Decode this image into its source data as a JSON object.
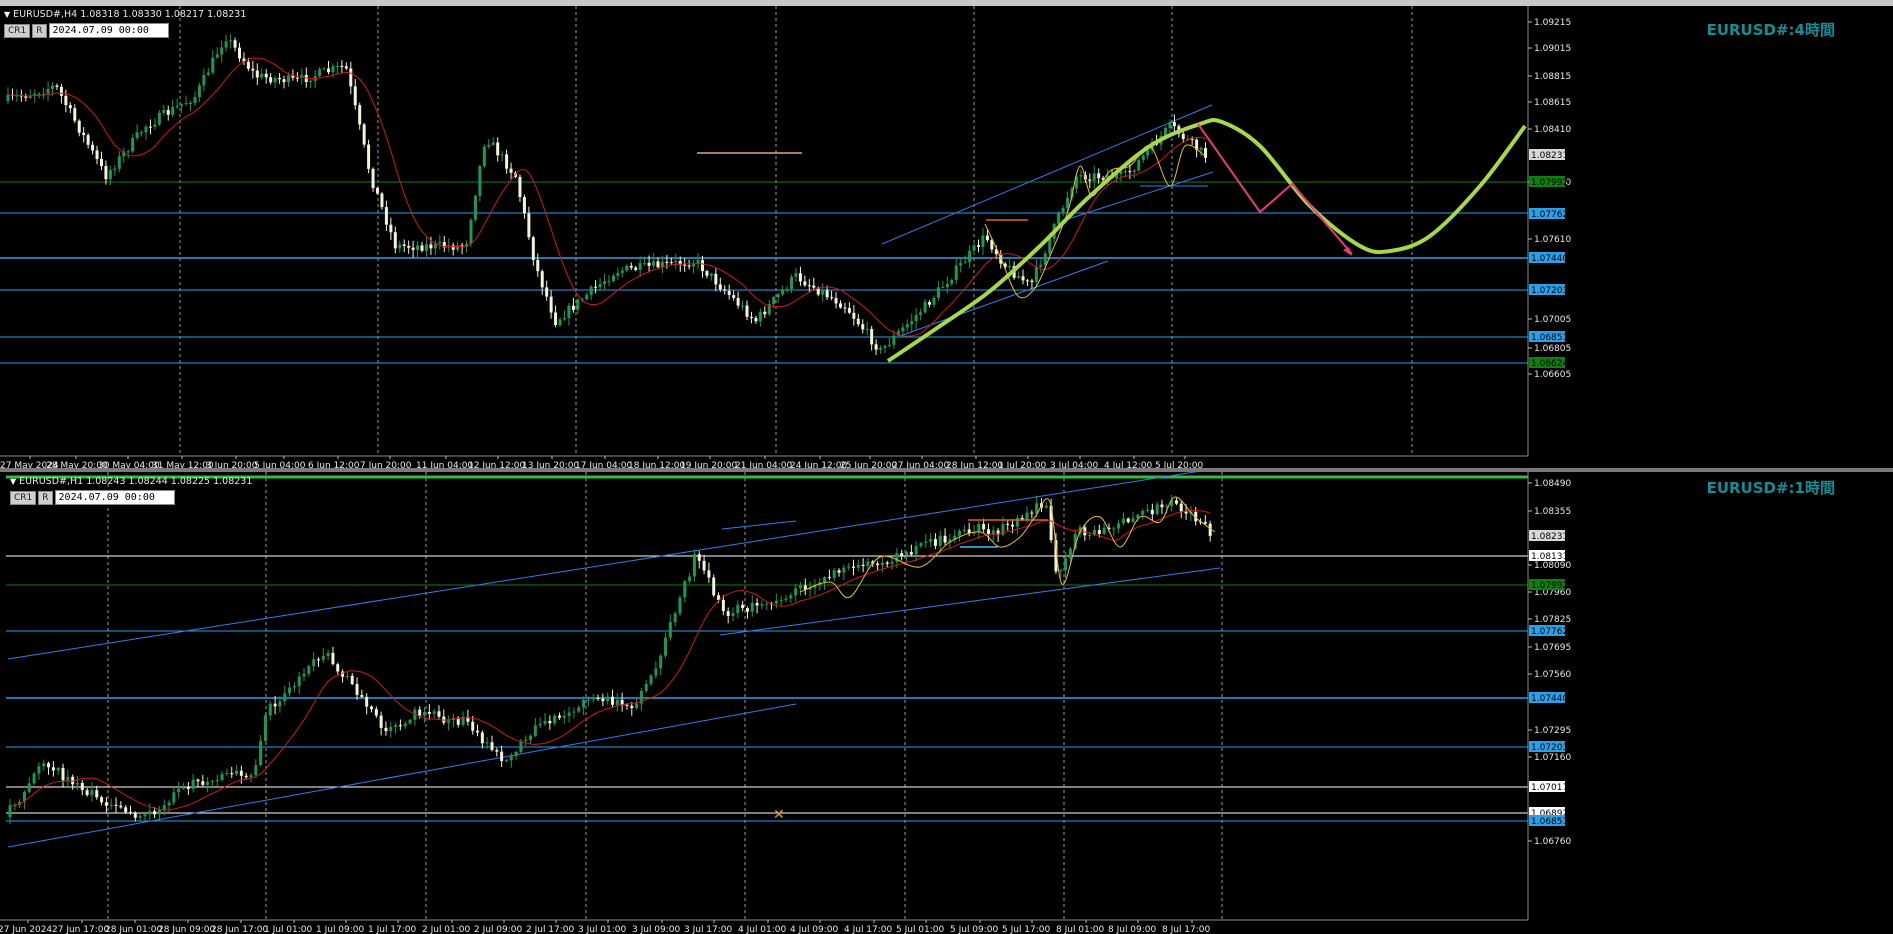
{
  "colors": {
    "background": "#000000",
    "bull": "#1a9a55",
    "bear": "#f4f4d8",
    "ma": "#d11818",
    "hline": "#2aa0e8",
    "trend": "#2f7fe8",
    "green_curve": "#a8d848",
    "zigzag": "#e8c020",
    "arrow": "#e83a78",
    "title": "#0f8f96",
    "green_level": "#0f7f0f"
  },
  "top_pane": {
    "header": "EURUSD#,H4  1.08318 1.08330 1.08217 1.08231",
    "btn_cr": "CR1",
    "btn_r": "R",
    "date_value": "2024.07.09 00:00",
    "title": "EURUSD#:4時間",
    "price_labels": [
      "1.09215",
      "1.09015",
      "1.08815",
      "1.08615",
      "1.08410",
      "1.08010",
      "1.07610",
      "1.07005",
      "1.06805",
      "1.06605"
    ],
    "level_tags": [
      {
        "text": "1.08231",
        "kind": "current"
      },
      {
        "text": "1.07992",
        "kind": "green"
      },
      {
        "text": "1.07762",
        "kind": "blue"
      },
      {
        "text": "1.07440",
        "kind": "blue"
      },
      {
        "text": "1.07203",
        "kind": "blue"
      },
      {
        "text": "1.06851",
        "kind": "blue"
      },
      {
        "text": "1.06624",
        "kind": "green"
      }
    ],
    "time_labels": [
      "27 May 2024",
      "28 May 20:00",
      "30 May 04:00",
      "31 May 12:00",
      "3 Jun 20:00",
      "5 Jun 04:00",
      "6 Jun 12:00",
      "7 Jun 20:00",
      "11 Jun 04:00",
      "12 Jun 12:00",
      "13 Jun 20:00",
      "17 Jun 04:00",
      "18 Jun 12:00",
      "19 Jun 20:00",
      "21 Jun 04:00",
      "24 Jun 12:00",
      "25 Jun 20:00",
      "27 Jun 04:00",
      "28 Jun 12:00",
      "1 Jul 20:00",
      "3 Jul 04:00",
      "4 Jul 12:00",
      "5 Jul 20:00"
    ]
  },
  "bottom_pane": {
    "header": "EURUSD#,H1  1.08243 1.08244 1.08225 1.08231",
    "btn_cr": "CR1",
    "btn_r": "R",
    "date_value": "2024.07.09 00:00",
    "title": "EURUSD#:1時間",
    "price_labels": [
      "1.08490",
      "1.08355",
      "1.08090",
      "1.07960",
      "1.07825",
      "1.07695",
      "1.07560",
      "1.07295",
      "1.07160",
      "1.06760"
    ],
    "level_tags": [
      {
        "text": "1.08231",
        "kind": "current"
      },
      {
        "text": "1.08131",
        "kind": "white"
      },
      {
        "text": "1.07992",
        "kind": "green"
      },
      {
        "text": "1.07762",
        "kind": "blue"
      },
      {
        "text": "1.07440",
        "kind": "blue"
      },
      {
        "text": "1.07203",
        "kind": "blue"
      },
      {
        "text": "1.07017",
        "kind": "white"
      },
      {
        "text": "1.06892",
        "kind": "white"
      },
      {
        "text": "1.06851",
        "kind": "blue"
      }
    ],
    "time_labels": [
      "27 Jun 2024",
      "27 Jun 17:00",
      "28 Jun 01:00",
      "28 Jun 09:00",
      "28 Jun 17:00",
      "1 Jul 01:00",
      "1 Jul 09:00",
      "1 Jul 17:00",
      "2 Jul 01:00",
      "2 Jul 09:00",
      "2 Jul 17:00",
      "3 Jul 01:00",
      "3 Jul 09:00",
      "3 Jul 17:00",
      "4 Jul 01:00",
      "4 Jul 09:00",
      "4 Jul 17:00",
      "5 Jul 01:00",
      "5 Jul 09:00",
      "5 Jul 17:00",
      "8 Jul 01:00",
      "8 Jul 09:00",
      "8 Jul 17:00"
    ]
  }
}
